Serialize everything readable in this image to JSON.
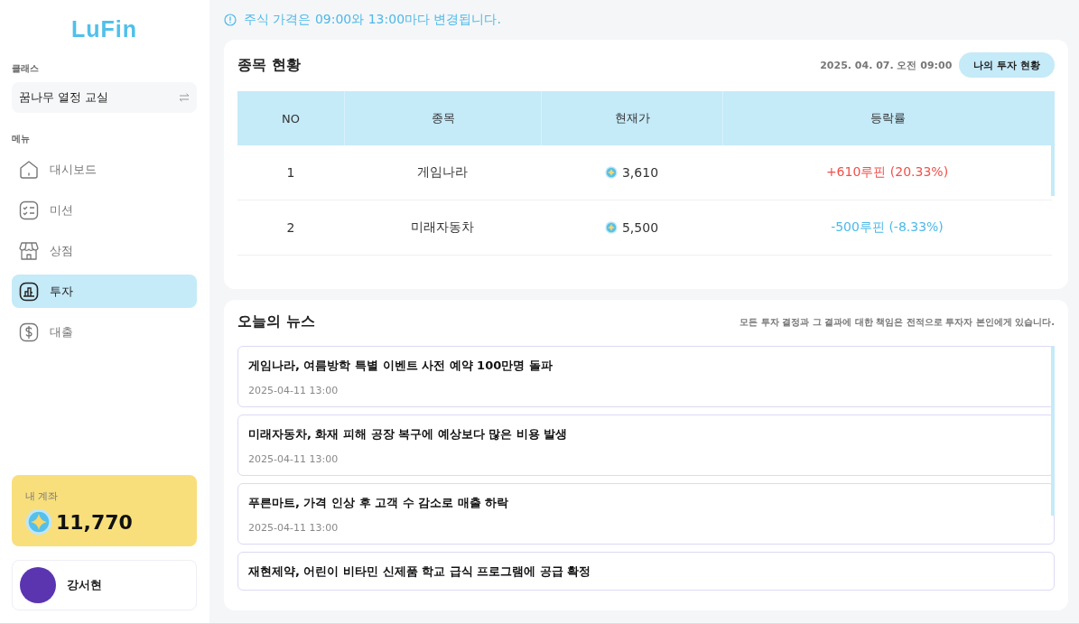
{
  "sidebar": {
    "logo": "LuFin",
    "class_label": "클래스",
    "class_name": "꿈나무 열정 교실",
    "menu_label": "메뉴",
    "items": [
      {
        "label": "대시보드",
        "kind": "home",
        "selected": false
      },
      {
        "label": "미션",
        "kind": "list",
        "selected": false
      },
      {
        "label": "상점",
        "kind": "store",
        "selected": false
      },
      {
        "label": "투자",
        "kind": "chart",
        "selected": true
      },
      {
        "label": "대출",
        "kind": "dollar",
        "selected": false
      }
    ],
    "account": {
      "label": "내 계좌",
      "balance": "11,770"
    },
    "user": {
      "name": "강서현"
    }
  },
  "notice": "주식 가격은 09:00와 13:00마다 변경됩니다.",
  "stocks": {
    "title": "종목 현황",
    "timestamp": "2025. 04. 07. 오전 09:00",
    "button": "나의 투자 현황",
    "columns": [
      "NO",
      "종목",
      "현재가",
      "등락률"
    ],
    "rows": [
      {
        "no": "1",
        "name": "게임나라",
        "price": "3,610",
        "change": "+610루핀 (20.33%)",
        "kind": "up"
      },
      {
        "no": "2",
        "name": "미래자동차",
        "price": "5,500",
        "change": "-500루핀 (-8.33%)",
        "kind": "down"
      }
    ]
  },
  "news": {
    "title": "오늘의 뉴스",
    "disclaimer": "모든 투자 결정과 그 결과에 대한 책임은 전적으로 투자자 본인에게 있습니다.",
    "items": [
      {
        "headline": "게임나라, 여름방학 특별 이벤트 사전 예약 100만명 돌파",
        "date": "2025-04-11 13:00"
      },
      {
        "headline": "미래자동차, 화재 피해 공장 복구에 예상보다 많은 비용 발생",
        "date": "2025-04-11 13:00"
      },
      {
        "headline": "푸른마트, 가격 인상 후 고객 수 감소로 매출 하락",
        "date": "2025-04-11 13:00"
      },
      {
        "headline": "재현제약, 어린이 비타민 신제품 학교 급식 프로그램에 공급 확정"
      }
    ]
  }
}
